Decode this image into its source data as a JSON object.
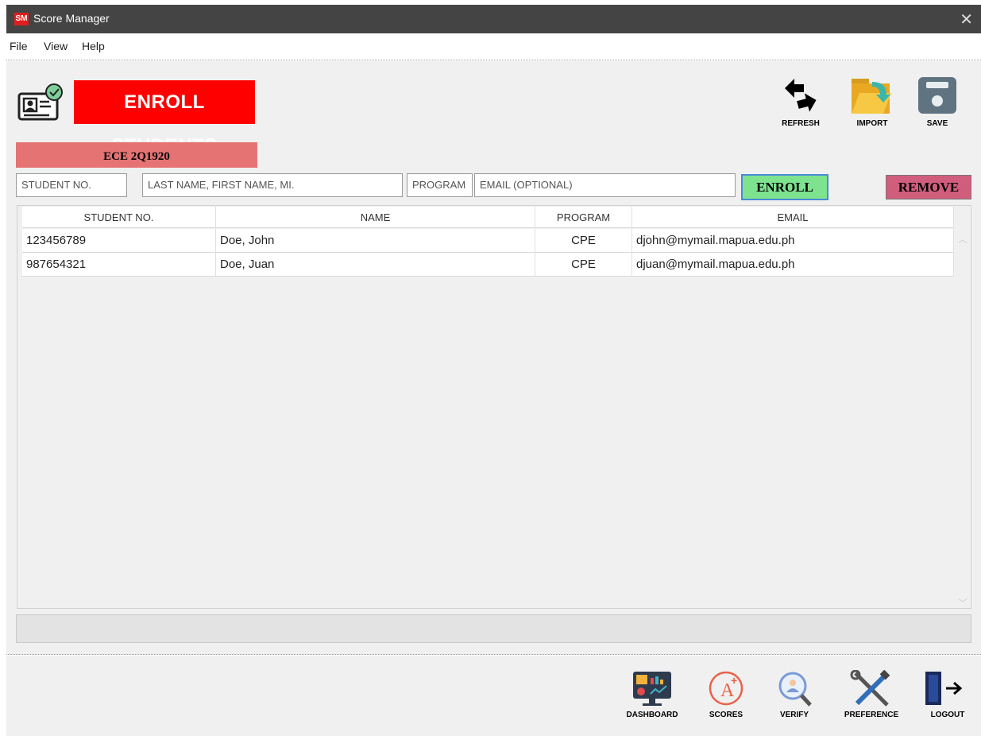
{
  "window": {
    "title": "Score Manager",
    "icon_text": "SM"
  },
  "menu": [
    "File",
    "View",
    "Help"
  ],
  "header": {
    "banner": "ENROLL STUDENTS",
    "course": "ECE 2Q1920"
  },
  "toolbar": {
    "refresh": "REFRESH",
    "import": "IMPORT",
    "save": "SAVE"
  },
  "form": {
    "student_no_placeholder": "STUDENT NO.",
    "name_placeholder": "LAST NAME, FIRST NAME, MI.",
    "program_placeholder": "PROGRAM",
    "email_placeholder": "EMAIL (OPTIONAL)",
    "enroll": "ENROLL",
    "remove": "REMOVE"
  },
  "table": {
    "columns": [
      "STUDENT NO.",
      "NAME",
      "PROGRAM",
      "EMAIL"
    ],
    "rows": [
      [
        "123456789",
        "Doe, John",
        "CPE",
        "djohn@mymail.mapua.edu.ph"
      ],
      [
        "987654321",
        "Doe, Juan",
        "CPE",
        "djuan@mymail.mapua.edu.ph"
      ]
    ]
  },
  "nav": {
    "dashboard": "DASHBOARD",
    "scores": "SCORES",
    "verify": "VERIFY",
    "preference": "PREFERENCE",
    "logout": "LOGOUT"
  },
  "colors": {
    "banner": "#ff0000",
    "course": "#e57373",
    "enroll": "#7de38f",
    "remove": "#d15d7d",
    "titlebar": "#444444"
  }
}
